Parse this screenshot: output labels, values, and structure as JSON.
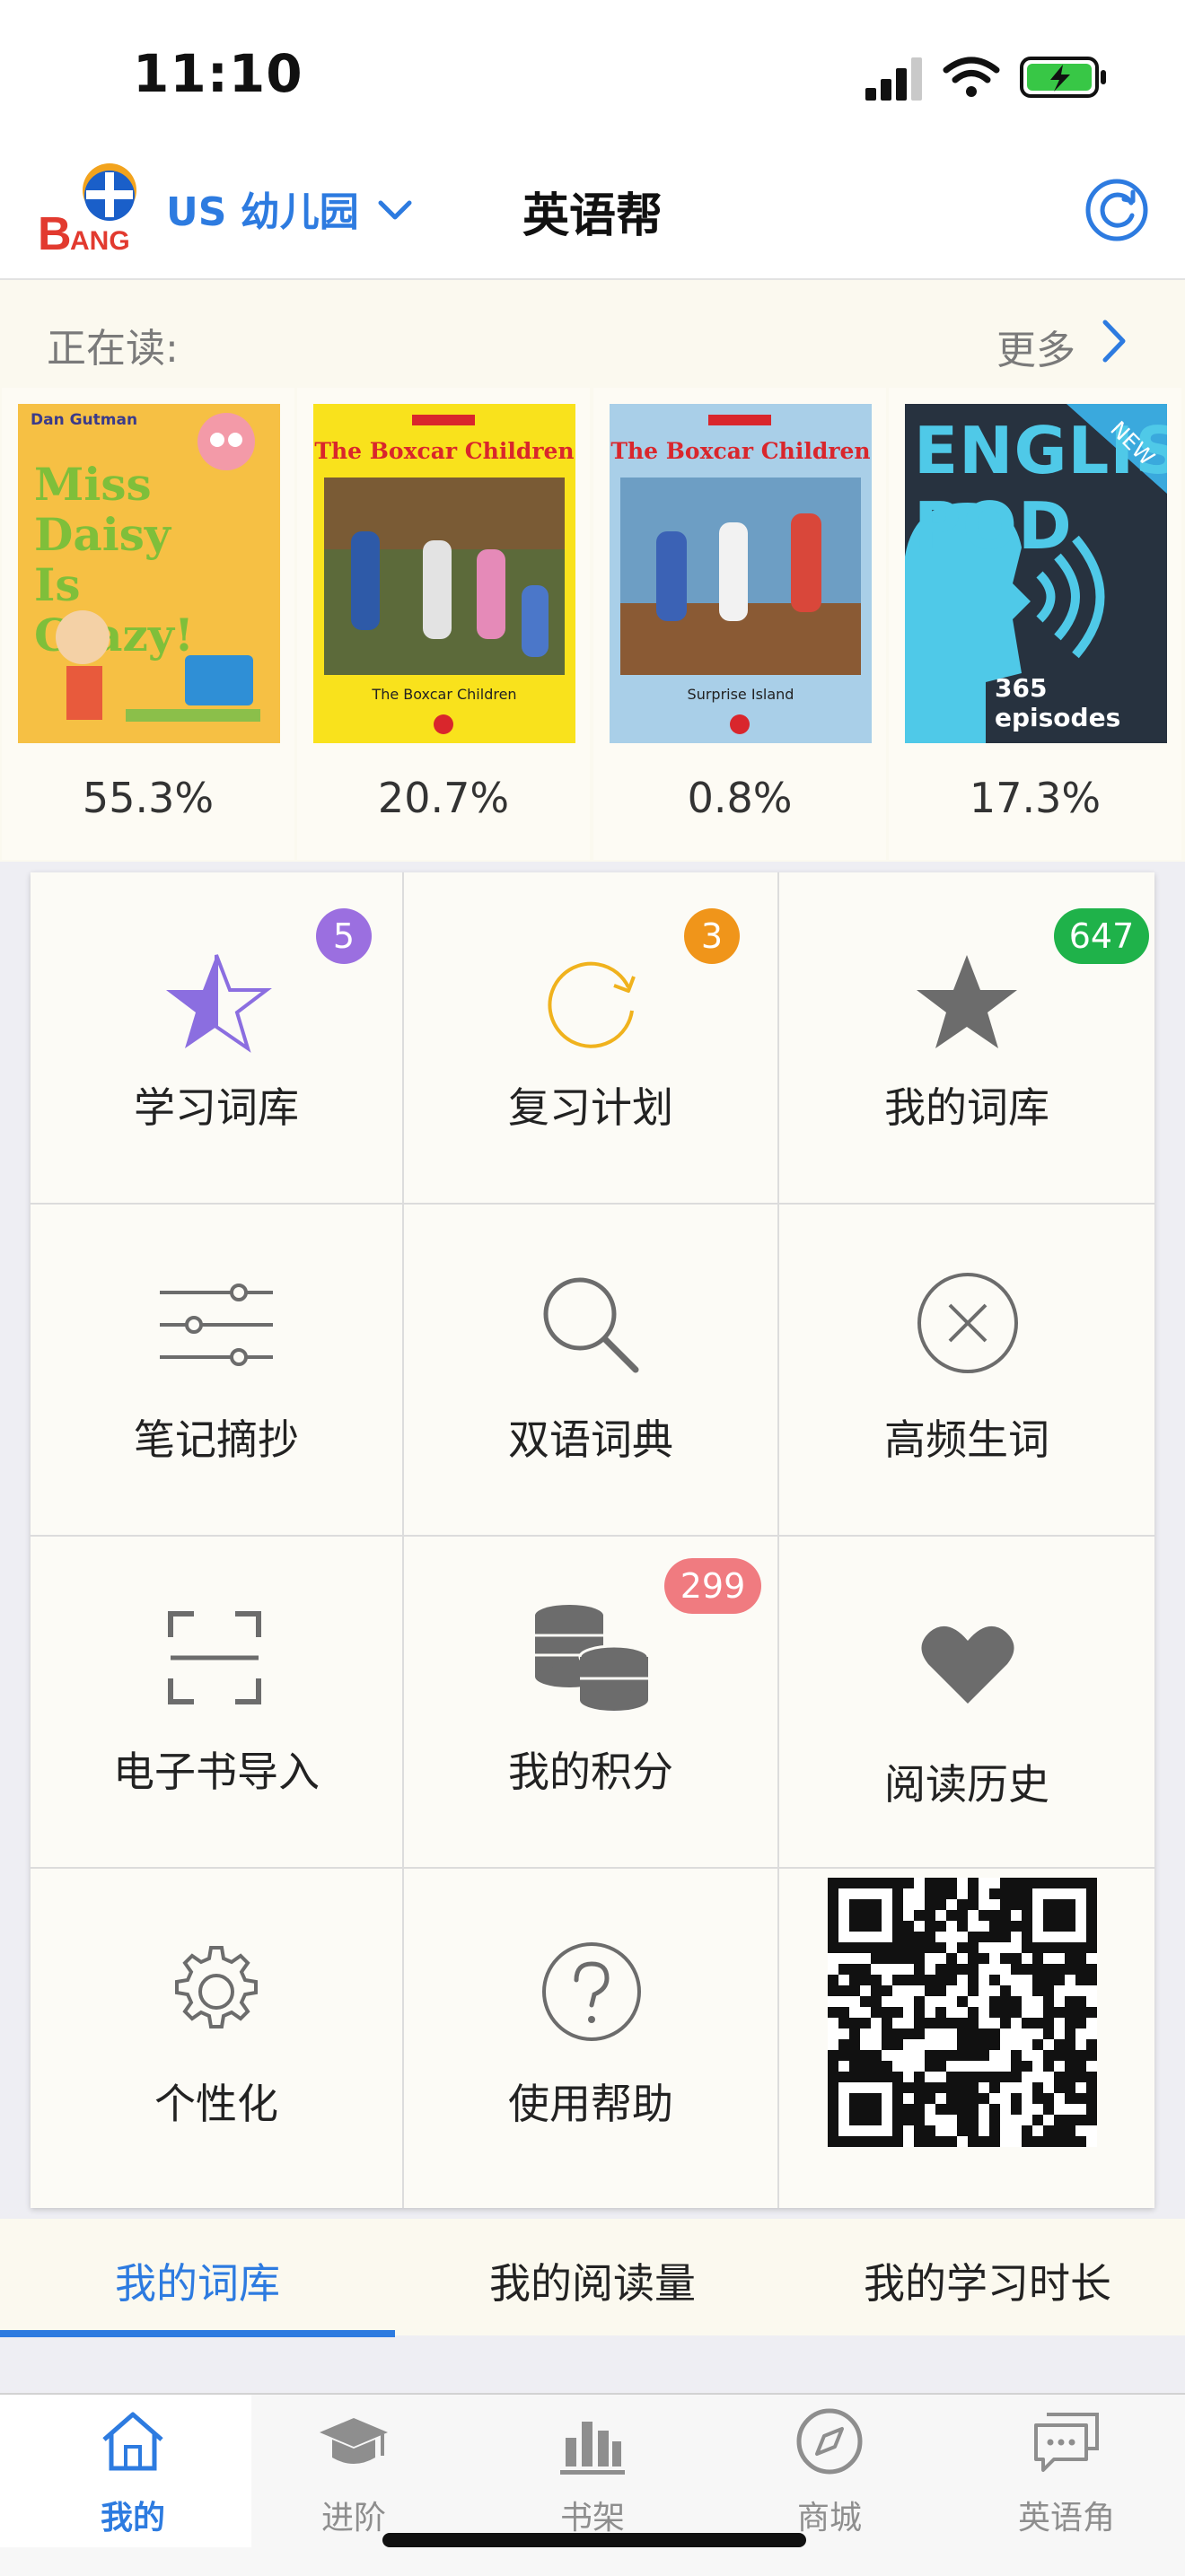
{
  "status_bar": {
    "time": "11:10"
  },
  "header": {
    "logo_text": "BANG",
    "level": "US 幼儿园",
    "title": "英语帮"
  },
  "reading": {
    "label": "正在读:",
    "more": "更多",
    "books": [
      {
        "cover_title": "Miss Daisy Is Crazy!",
        "cover_author": "Dan Gutman",
        "progress": "55.3%"
      },
      {
        "cover_title": "The Boxcar Children",
        "cover_subtitle": "The Boxcar Children",
        "progress": "20.7%"
      },
      {
        "cover_title": "The Boxcar Children",
        "cover_subtitle": "Surprise Island",
        "progress": "0.8%"
      },
      {
        "cover_title": "ENGLISH POD",
        "cover_subtitle": "365 episodes",
        "cover_tag": "NEW",
        "progress": "17.3%"
      }
    ]
  },
  "grid": {
    "items": [
      {
        "label": "学习词库",
        "icon": "star-half-icon",
        "badge": "5"
      },
      {
        "label": "复习计划",
        "icon": "refresh-icon",
        "badge": "3"
      },
      {
        "label": "我的词库",
        "icon": "star-icon",
        "badge": "647"
      },
      {
        "label": "笔记摘抄",
        "icon": "sliders-icon"
      },
      {
        "label": "双语词典",
        "icon": "search-icon"
      },
      {
        "label": "高频生词",
        "icon": "close-circle-icon"
      },
      {
        "label": "电子书导入",
        "icon": "scan-icon"
      },
      {
        "label": "我的积分",
        "icon": "coins-icon",
        "badge": "299"
      },
      {
        "label": "阅读历史",
        "icon": "heart-icon"
      },
      {
        "label": "个性化",
        "icon": "gear-icon"
      },
      {
        "label": "使用帮助",
        "icon": "help-icon"
      },
      {
        "icon": "qr-code-icon"
      }
    ]
  },
  "stats_tabs": [
    "我的词库",
    "我的阅读量",
    "我的学习时长"
  ],
  "tab_bar": [
    {
      "label": "我的",
      "icon": "home-icon",
      "active": true
    },
    {
      "label": "进阶",
      "icon": "graduation-cap-icon"
    },
    {
      "label": "书架",
      "icon": "bar-chart-icon"
    },
    {
      "label": "商城",
      "icon": "compass-icon"
    },
    {
      "label": "英语角",
      "icon": "chat-icon"
    }
  ],
  "colors": {
    "accent": "#2d7be0",
    "badge_purple": "#9b6fe0",
    "badge_orange": "#f0951a",
    "badge_green": "#1fb24a",
    "badge_pink": "#f07b80"
  }
}
